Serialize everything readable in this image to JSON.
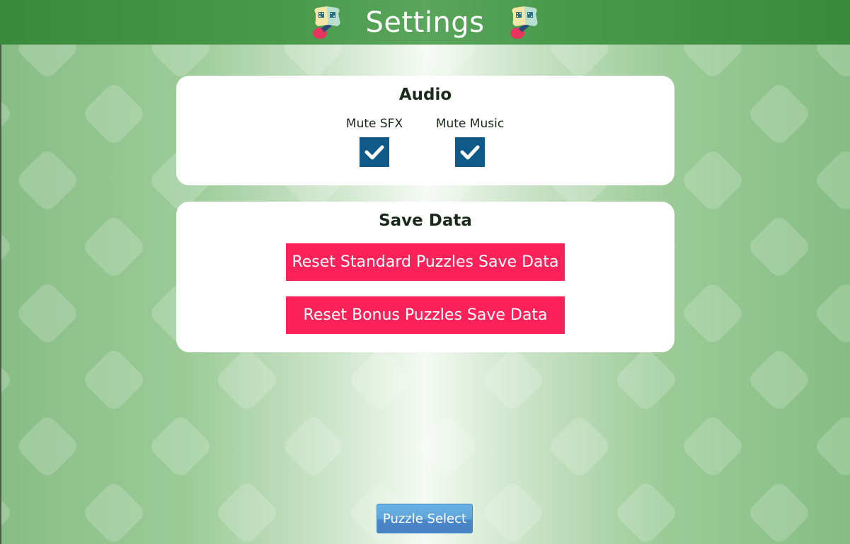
{
  "header": {
    "title": "Settings",
    "icon_left": "puzzle-book-icon",
    "icon_right": "puzzle-book-icon"
  },
  "audio": {
    "title": "Audio",
    "options": [
      {
        "label": "Mute SFX",
        "checked": true
      },
      {
        "label": "Mute Music",
        "checked": true
      }
    ]
  },
  "save_data": {
    "title": "Save Data",
    "reset_standard_label": "Reset Standard Puzzles Save Data",
    "reset_bonus_label": "Reset Bonus Puzzles Save Data"
  },
  "footer": {
    "puzzle_select_label": "Puzzle Select"
  },
  "colors": {
    "header_green": "#3a8a3c",
    "checkbox_blue": "#0f5a88",
    "reset_button_pink": "#fd2159",
    "nav_button_blue": "#5fa6dc"
  }
}
